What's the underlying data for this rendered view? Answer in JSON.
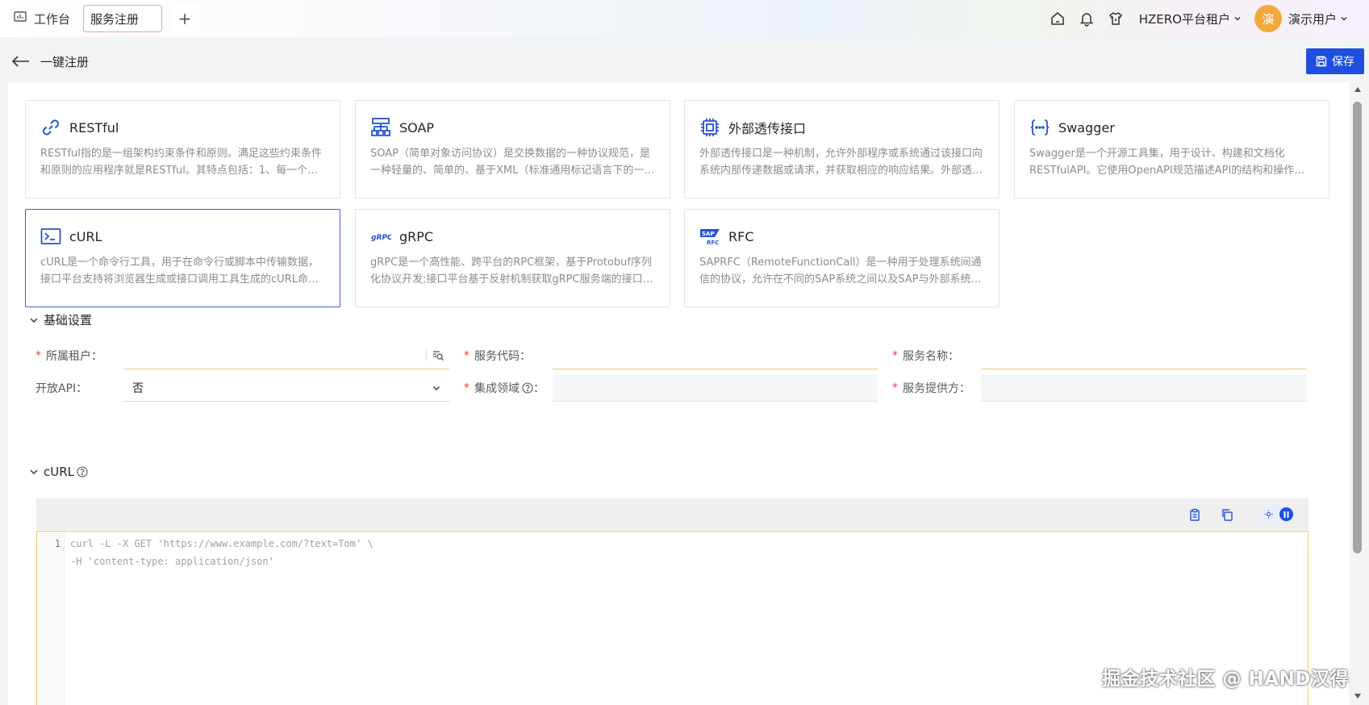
{
  "topbar": {
    "home_tab": "工作台",
    "active_tab": "服务注册",
    "add_tab": "+",
    "tenant": "HZERO平台租户",
    "avatar_char": "演",
    "username": "演示用户"
  },
  "header": {
    "title": "一键注册",
    "save_label": "保存"
  },
  "types": [
    {
      "title": "RESTful",
      "icon": "link-icon",
      "desc": "RESTful指的是一组架构约束条件和原则。满足这些约束条件和原则的应用程序就是RESTful。其特点包括：1、每一个URI代表一种资源；2、客户端和服务器之间传递这种资源的某种表现层"
    },
    {
      "title": "SOAP",
      "icon": "sitemap-icon",
      "desc": "SOAP（简单对象访问协议）是交换数据的一种协议规范，是一种轻量的、简单的、基于XML（标准通用标记语言下的一个子集）的协议，它被设计成在WEB上交换结构化的和固化的信息"
    },
    {
      "title": "外部透传接口",
      "icon": "chip-icon",
      "desc": "外部透传接口是一种机制，允许外部程序或系统通过该接口向系统内部传递数据或请求，并获取相应的响应结果。外部透传接口通常用于系统集成"
    },
    {
      "title": "Swagger",
      "icon": "braces-icon",
      "desc": "Swagger是一个开源工具集，用于设计、构建和文档化RESTfulAPI。它使用OpenAPI规范描述API的结构和操作，并提供了一系列工具来生成API文档"
    },
    {
      "title": "cURL",
      "icon": "terminal-icon",
      "desc": "cURL是一个命令行工具，用于在命令行或脚本中传输数据，接口平台支持将浏览器生成或接口调用工具生成的cURL命令一键解析注册为接口"
    },
    {
      "title": "gRPC",
      "icon": "grpc-icon",
      "icon_text": "gRPC",
      "desc": "gRPC是一个高性能、跨平台的RPC框架，基于Protobuf序列化协议开发;接口平台基于反射机制获取gRPC服务端的接口定义并一键注册"
    },
    {
      "title": "RFC",
      "icon": "sap-icon",
      "icon_text_top": "SAP",
      "icon_text_bottom": "RFC",
      "desc": "SAPRFC（RemoteFunctionCall）是一种用于处理系统间通信的协议，允许在不同的SAP系统之间以及SAP与外部系统之间进行函数调用"
    }
  ],
  "basic": {
    "title": "基础设置",
    "tenant_label": "所属租户：",
    "service_code_label": "服务代码：",
    "service_name_label": "服务名称：",
    "open_api_label": "开放API：",
    "open_api_value": "否",
    "domain_label": "集成领域",
    "domain_colon": "：",
    "provider_label": "服务提供方："
  },
  "curl": {
    "title": "cURL",
    "line_number": "1",
    "placeholder_line1": "curl -L -X GET 'https://www.example.com/?text=Tom' \\",
    "placeholder_line2": "-H 'content-type: application/json'"
  },
  "watermark": "掘金技术社区 @ HAND汉得",
  "colors": {
    "primary": "#1f4fe0",
    "required": "#e8413d",
    "focus_border": "#f0c76b",
    "avatar": "#f2a93b"
  }
}
